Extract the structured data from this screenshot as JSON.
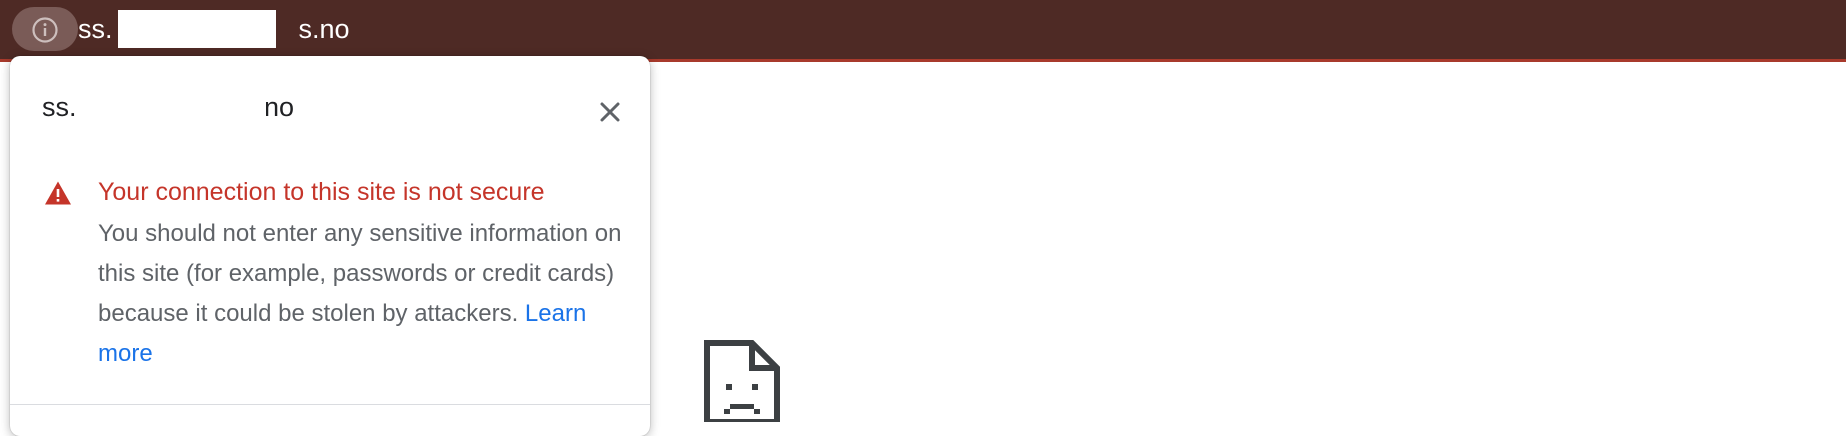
{
  "toolbar": {
    "site_info_icon": "info-circle-icon",
    "url_prefix": "ss.",
    "url_suffix": "s.no"
  },
  "popup": {
    "host_prefix": "ss.",
    "host_suffix": ".no",
    "close_icon": "close-icon",
    "warning": {
      "icon": "warning-triangle-icon",
      "title": "Your connection to this site is not secure",
      "body": "You should not enter any sensitive information on this site (for example, passwords or credit cards) because it could be stolen by attackers.",
      "link": "Learn more"
    }
  },
  "page": {
    "error_icon": "sad-document-icon"
  },
  "colors": {
    "toolbar_bg": "#4e2a25",
    "warning_red": "#c5352a",
    "link_blue": "#1a73e8"
  }
}
